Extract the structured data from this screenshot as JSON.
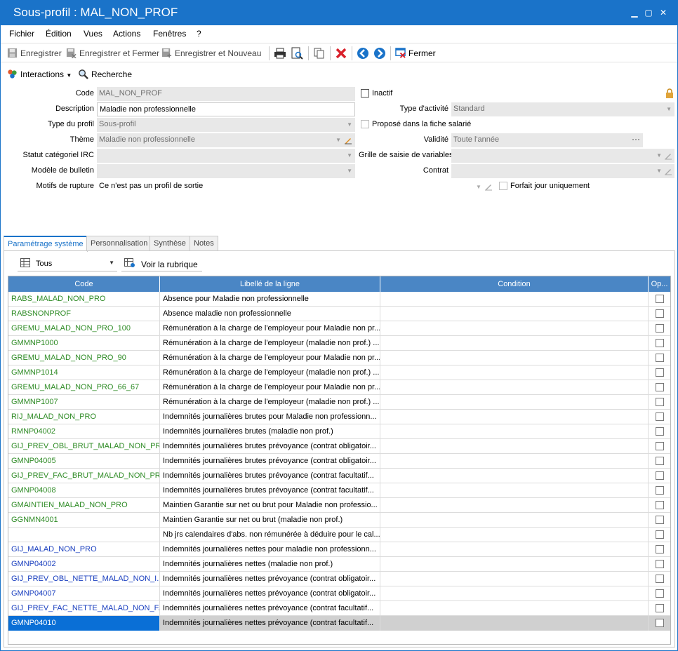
{
  "window": {
    "title": "Sous-profil : MAL_NON_PROF",
    "minimize": "▁",
    "maximize": "▢",
    "close": "✕"
  },
  "menu": [
    "Fichier",
    "Édition",
    "Vues",
    "Actions",
    "Fenêtres",
    "?"
  ],
  "toolbar": {
    "save": "Enregistrer",
    "save_close": "Enregistrer et Fermer",
    "save_new": "Enregistrer et Nouveau",
    "close": "Fermer"
  },
  "toolbar2": {
    "interactions": "Interactions",
    "search": "Recherche"
  },
  "form": {
    "code_label": "Code",
    "code_value": "MAL_NON_PROF",
    "description_label": "Description",
    "description_value": "Maladie non professionnelle",
    "type_profil_label": "Type du profil",
    "type_profil_value": "Sous-profil",
    "theme_label": "Thème",
    "theme_value": "Maladie non professionnelle",
    "statut_label": "Statut catégoriel IRC",
    "statut_value": "",
    "modele_label": "Modèle de bulletin",
    "modele_value": "",
    "motifs_label": "Motifs de rupture",
    "motifs_value": "Ce n'est pas un profil de sortie",
    "inactif_label": "Inactif",
    "type_activite_label": "Type d'activité",
    "type_activite_value": "Standard",
    "propose_label": "Proposé dans la fiche salarié",
    "validite_label": "Validité",
    "validite_value": "Toute l'année",
    "validite_more": "···",
    "grille_label": "Grille de saisie de variables",
    "grille_value": "",
    "contrat_label": "Contrat",
    "contrat_value": "",
    "forfait_label": "Forfait jour uniquement"
  },
  "tabs": [
    "Paramétrage système",
    "Personnalisation",
    "Synthèse",
    "Notes"
  ],
  "filter": {
    "value": "Tous",
    "voir_rubrique": "Voir la rubrique"
  },
  "grid": {
    "headers": [
      "Code",
      "Libellé de la ligne",
      "Condition",
      "Op..."
    ],
    "rows": [
      {
        "code": "RABS_MALAD_NON_PRO",
        "label": "Absence pour Maladie non professionnelle",
        "color": "green"
      },
      {
        "code": "RABSNONPROF",
        "label": "Absence maladie non professionnelle",
        "color": "green"
      },
      {
        "code": "GREMU_MALAD_NON_PRO_100",
        "label": "Rémunération à la charge de l'employeur pour Maladie non pr...",
        "color": "green"
      },
      {
        "code": "GMMNP1000",
        "label": "Rémunération à la charge de l'employeur (maladie non prof.) ...",
        "color": "green"
      },
      {
        "code": "GREMU_MALAD_NON_PRO_90",
        "label": "Rémunération à la charge de l'employeur pour Maladie non pr...",
        "color": "green"
      },
      {
        "code": "GMMNP1014",
        "label": "Rémunération à la charge de l'employeur (maladie non prof.) ...",
        "color": "green"
      },
      {
        "code": "GREMU_MALAD_NON_PRO_66_67",
        "label": "Rémunération à la charge de l'employeur pour Maladie non pr...",
        "color": "green"
      },
      {
        "code": "GMMNP1007",
        "label": "Rémunération à la charge de l'employeur (maladie non prof.) ...",
        "color": "green"
      },
      {
        "code": "RIJ_MALAD_NON_PRO",
        "label": "Indemnités journalières brutes pour Maladie non professionn...",
        "color": "green"
      },
      {
        "code": "RMNP04002",
        "label": "Indemnités journalières brutes (maladie non prof.)",
        "color": "green"
      },
      {
        "code": "GIJ_PREV_OBL_BRUT_MALAD_NON_PRO",
        "label": "Indemnités journalières brutes prévoyance (contrat obligatoir...",
        "color": "green"
      },
      {
        "code": "GMNP04005",
        "label": "Indemnités journalières brutes prévoyance (contrat obligatoir...",
        "color": "green"
      },
      {
        "code": "GIJ_PREV_FAC_BRUT_MALAD_NON_PRO",
        "label": "Indemnités journalières brutes prévoyance (contrat facultatif...",
        "color": "green"
      },
      {
        "code": "GMNP04008",
        "label": "Indemnités journalières brutes prévoyance (contrat facultatif...",
        "color": "green"
      },
      {
        "code": "GMAINTIEN_MALAD_NON_PRO",
        "label": "Maintien Garantie sur net ou brut pour Maladie non professio...",
        "color": "green"
      },
      {
        "code": "GGNMN4001",
        "label": "Maintien Garantie sur net ou brut (maladie non prof.)",
        "color": "green"
      },
      {
        "code": "",
        "label": "Nb jrs calendaires d'abs. non rémunérée à déduire pour le cal...",
        "color": "green"
      },
      {
        "code": "GIJ_MALAD_NON_PRO",
        "label": "Indemnités journalières nettes pour maladie non professionn...",
        "color": "blue"
      },
      {
        "code": "GMNP04002",
        "label": "Indemnités journalières nettes (maladie non prof.)",
        "color": "blue"
      },
      {
        "code": "GIJ_PREV_OBL_NETTE_MALAD_NON_I...",
        "label": "Indemnités journalières nettes prévoyance (contrat obligatoir...",
        "color": "blue"
      },
      {
        "code": "GMNP04007",
        "label": "Indemnités journalières nettes prévoyance (contrat obligatoir...",
        "color": "blue"
      },
      {
        "code": "GIJ_PREV_FAC_NETTE_MALAD_NON_F...",
        "label": "Indemnités journalières nettes prévoyance (contrat facultatif...",
        "color": "blue"
      },
      {
        "code": "GMNP04010",
        "label": "Indemnités journalières nettes prévoyance (contrat facultatif...",
        "color": "blue",
        "selected": true
      }
    ]
  },
  "colors": {
    "accent": "#1a73c9",
    "header": "#4a86c5",
    "green": "#2e8b25",
    "blue": "#1a3fbf",
    "selection": "#0a6fd6"
  }
}
